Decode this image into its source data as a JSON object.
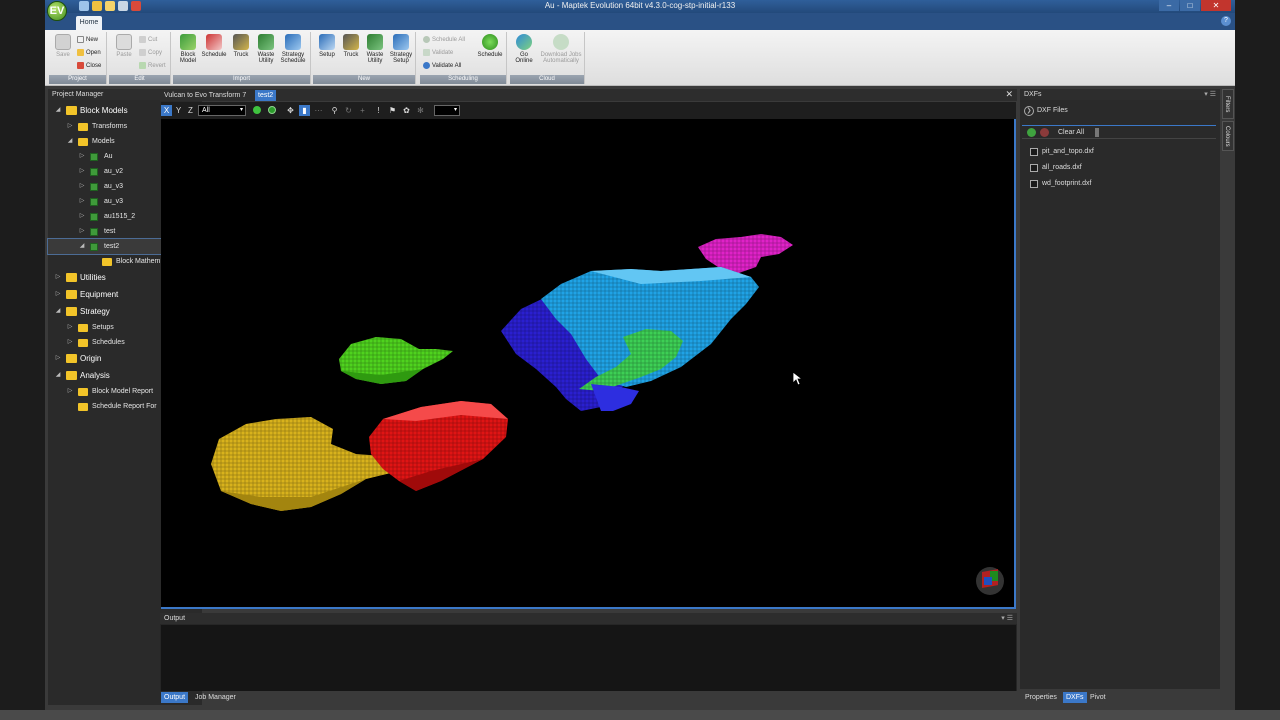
{
  "window": {
    "title": "Au - Maptek Evolution 64bit v4.3.0-cog-stp-initial-r133",
    "logo_text": "EV",
    "min": "–",
    "max": "□",
    "close": "✕"
  },
  "ribbon": {
    "tab": "Home",
    "help": "?",
    "groups": {
      "project": {
        "label": "Project",
        "save": "Save",
        "new": "New",
        "open": "Open",
        "close": "Close"
      },
      "edit": {
        "label": "Edit",
        "paste": "Paste",
        "cut": "Cut",
        "copy": "Copy",
        "revert": "Revert"
      },
      "import": {
        "label": "Import",
        "block_model": "Block\nModel",
        "schedule": "Schedule",
        "truck": "Truck",
        "waste_utility": "Waste\nUtility",
        "strategy_schedule": "Strategy\nSchedule"
      },
      "new": {
        "label": "New",
        "setup": "Setup",
        "truck": "Truck",
        "waste_utility": "Waste\nUtility",
        "strategy_setup": "Strategy\nSetup"
      },
      "scheduling": {
        "label": "Scheduling",
        "schedule_all": "Schedule All",
        "validate": "Validate",
        "validate_all": "Validate All",
        "schedule": "Schedule"
      },
      "cloud": {
        "label": "Cloud",
        "go_online": "Go\nOnline",
        "download_jobs": "Download Jobs\nAutomatically"
      }
    }
  },
  "project_manager": {
    "title": "Project Manager",
    "pin": "▾ ☰",
    "tree": [
      {
        "label": "Block Models",
        "level": 0,
        "kind": "folder",
        "arrow": "◢",
        "top": true
      },
      {
        "label": "Transforms",
        "level": 1,
        "kind": "folder",
        "arrow": "▷"
      },
      {
        "label": "Models",
        "level": 1,
        "kind": "folder",
        "arrow": "◢"
      },
      {
        "label": "Au",
        "level": 2,
        "kind": "model",
        "arrow": "▷"
      },
      {
        "label": "au_v2",
        "level": 2,
        "kind": "model",
        "arrow": "▷"
      },
      {
        "label": "au_v3",
        "level": 2,
        "kind": "model",
        "arrow": "▷"
      },
      {
        "label": "au_v3",
        "level": 2,
        "kind": "model",
        "arrow": "▷"
      },
      {
        "label": "au1515_2",
        "level": 2,
        "kind": "model",
        "arrow": "▷"
      },
      {
        "label": "test",
        "level": 2,
        "kind": "model",
        "arrow": "▷"
      },
      {
        "label": "test2",
        "level": 2,
        "kind": "model",
        "arrow": "◢",
        "selected": true
      },
      {
        "label": "Block Mathem",
        "level": 3,
        "kind": "folder",
        "arrow": ""
      },
      {
        "label": "Utilities",
        "level": 0,
        "kind": "folder",
        "arrow": "▷",
        "top": true
      },
      {
        "label": "Equipment",
        "level": 0,
        "kind": "folder",
        "arrow": "▷",
        "top": true
      },
      {
        "label": "Strategy",
        "level": 0,
        "kind": "folder",
        "arrow": "◢",
        "top": true
      },
      {
        "label": "Setups",
        "level": 1,
        "kind": "folder",
        "arrow": "▷"
      },
      {
        "label": "Schedules",
        "level": 1,
        "kind": "folder",
        "arrow": "▷"
      },
      {
        "label": "Origin",
        "level": 0,
        "kind": "folder",
        "arrow": "▷",
        "top": true
      },
      {
        "label": "Analysis",
        "level": 0,
        "kind": "folder",
        "arrow": "◢",
        "top": true
      },
      {
        "label": "Block Model Report",
        "level": 1,
        "kind": "folder",
        "arrow": "▷"
      },
      {
        "label": "Schedule Report For",
        "level": 1,
        "kind": "folder",
        "arrow": ""
      }
    ]
  },
  "document": {
    "tabs": [
      "Vulcan to Evo Transform 7",
      "test2"
    ],
    "active_tab": 1,
    "close": "✕",
    "toolbar": {
      "x": "X",
      "y": "Y",
      "z": "Z",
      "filter": "All"
    }
  },
  "output": {
    "title": "Output",
    "pin": "▾ ☰",
    "tabs": [
      "Output",
      "Job Manager"
    ]
  },
  "dxf_panel": {
    "title": "DXFs",
    "pin": "▾ ☰",
    "subheader": "DXF Files",
    "subheader_icon": "❯",
    "clear_all": "Clear All",
    "files": [
      "pit_and_topo.dxf",
      "all_roads.dxf",
      "wd_footprint.dxf"
    ],
    "side_tabs": [
      "Filters",
      "Colours"
    ],
    "bottom_tabs": [
      "Properties",
      "DXFs",
      "Pivot"
    ]
  },
  "colors": {
    "accent": "#3b78c8",
    "ore_yellow": "#d8b21c",
    "ore_red": "#e01414",
    "ore_green": "#4fd21e",
    "ore_blue": "#1fa3e6",
    "ore_dark_blue": "#2a1fd0",
    "ore_magenta": "#e022c8"
  }
}
